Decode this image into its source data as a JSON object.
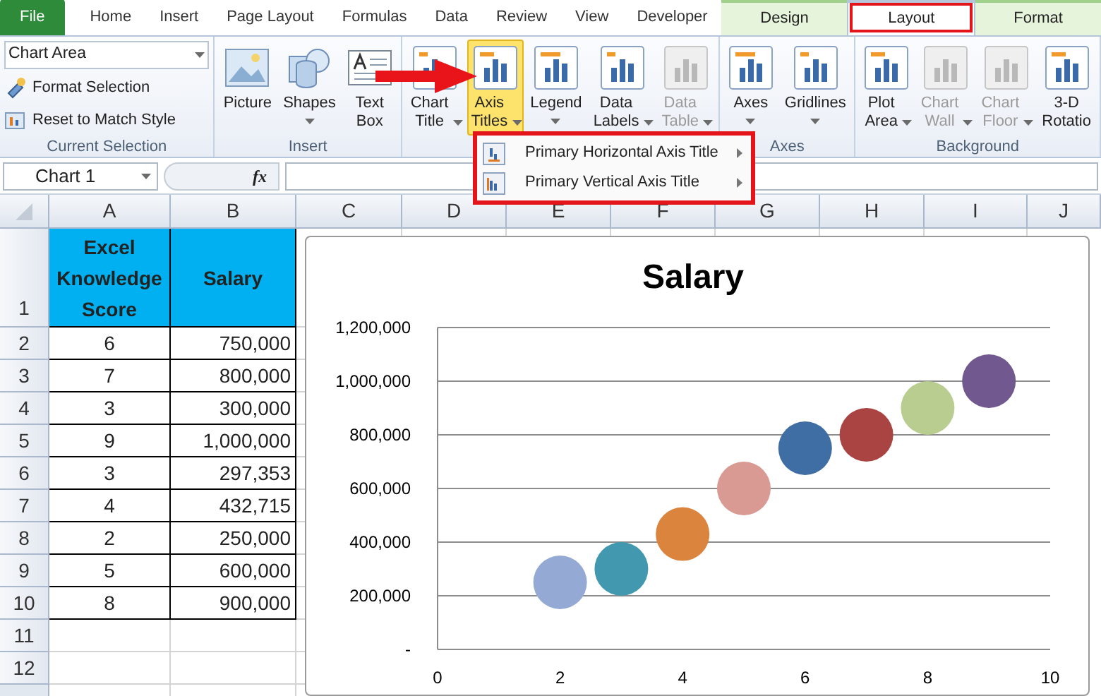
{
  "tabs": [
    {
      "label": "File",
      "kind": "file",
      "selected": false,
      "contextual": false,
      "highlighted": false
    },
    {
      "label": "Home",
      "kind": "tab",
      "selected": false,
      "contextual": false,
      "highlighted": false
    },
    {
      "label": "Insert",
      "kind": "tab",
      "selected": false,
      "contextual": false,
      "highlighted": false
    },
    {
      "label": "Page Layout",
      "kind": "tab",
      "selected": false,
      "contextual": false,
      "highlighted": false
    },
    {
      "label": "Formulas",
      "kind": "tab",
      "selected": false,
      "contextual": false,
      "highlighted": false
    },
    {
      "label": "Data",
      "kind": "tab",
      "selected": false,
      "contextual": false,
      "highlighted": false
    },
    {
      "label": "Review",
      "kind": "tab",
      "selected": false,
      "contextual": false,
      "highlighted": false
    },
    {
      "label": "View",
      "kind": "tab",
      "selected": false,
      "contextual": false,
      "highlighted": false
    },
    {
      "label": "Developer",
      "kind": "tab",
      "selected": false,
      "contextual": false,
      "highlighted": false
    },
    {
      "label": "Design",
      "kind": "tab",
      "selected": false,
      "contextual": true,
      "highlighted": false
    },
    {
      "label": "Layout",
      "kind": "tab",
      "selected": true,
      "contextual": true,
      "highlighted": true
    },
    {
      "label": "Format",
      "kind": "tab",
      "selected": false,
      "contextual": true,
      "highlighted": false
    }
  ],
  "ribbon": {
    "groups": [
      {
        "kind": "selection",
        "label": "Current Selection",
        "dropdown": "Chart Area",
        "items": [
          "Format Selection",
          "Reset to Match Style"
        ]
      },
      {
        "kind": "buttons",
        "label": "Insert",
        "buttons": [
          {
            "label": "Picture",
            "dropdown": false,
            "disabled": false,
            "selected": false
          },
          {
            "label": "Shapes",
            "dropdown": true,
            "disabled": false,
            "selected": false
          },
          {
            "label": "Text Box",
            "dropdown": false,
            "disabled": false,
            "selected": false
          }
        ]
      },
      {
        "kind": "buttons",
        "buttons": [
          {
            "label": "Chart Title",
            "dropdown": true,
            "disabled": false,
            "selected": false
          },
          {
            "label": "Axis Titles",
            "dropdown": true,
            "disabled": false,
            "selected": true
          },
          {
            "label": "Legend",
            "dropdown": true,
            "disabled": false,
            "selected": false
          },
          {
            "label": "Data Labels",
            "dropdown": true,
            "disabled": false,
            "selected": false
          },
          {
            "label": "Data Table",
            "dropdown": true,
            "disabled": true,
            "selected": false
          }
        ]
      },
      {
        "kind": "buttons",
        "label": "Axes",
        "buttons": [
          {
            "label": "Axes",
            "dropdown": true,
            "disabled": false,
            "selected": false
          },
          {
            "label": "Gridlines",
            "dropdown": true,
            "disabled": false,
            "selected": false
          }
        ]
      },
      {
        "kind": "buttons",
        "label": "Background",
        "buttons": [
          {
            "label": "Plot Area",
            "dropdown": true,
            "disabled": false,
            "selected": false
          },
          {
            "label": "Chart Wall",
            "dropdown": true,
            "disabled": true,
            "selected": false
          },
          {
            "label": "Chart Floor",
            "dropdown": true,
            "disabled": true,
            "selected": false
          },
          {
            "label": "3-D Rotatio",
            "dropdown": false,
            "disabled": false,
            "selected": false
          }
        ]
      }
    ]
  },
  "menu": {
    "highlighted": true,
    "items": [
      {
        "label": "Primary Horizontal Axis Title"
      },
      {
        "label": "Primary Vertical Axis Title"
      }
    ]
  },
  "formula_bar": {
    "name_box": "Chart 1",
    "fx": "fx"
  },
  "sheet": {
    "columns": [
      "A",
      "B",
      "C",
      "D",
      "E",
      "F",
      "G",
      "H",
      "I",
      "J"
    ],
    "rows": [
      {
        "number": "1",
        "cells": [
          "Excel Knowledge Score",
          "Salary"
        ],
        "header": true
      },
      {
        "number": "2",
        "cells": [
          "6",
          "750,000"
        ],
        "header": false
      },
      {
        "number": "3",
        "cells": [
          "7",
          "800,000"
        ],
        "header": false
      },
      {
        "number": "4",
        "cells": [
          "3",
          "300,000"
        ],
        "header": false
      },
      {
        "number": "5",
        "cells": [
          "9",
          "1,000,000"
        ],
        "header": false
      },
      {
        "number": "6",
        "cells": [
          "3",
          "297,353"
        ],
        "header": false
      },
      {
        "number": "7",
        "cells": [
          "4",
          "432,715"
        ],
        "header": false
      },
      {
        "number": "8",
        "cells": [
          "2",
          "250,000"
        ],
        "header": false
      },
      {
        "number": "9",
        "cells": [
          "5",
          "600,000"
        ],
        "header": false
      },
      {
        "number": "10",
        "cells": [
          "8",
          "900,000"
        ],
        "header": false
      },
      {
        "number": "11",
        "cells": [],
        "header": false
      },
      {
        "number": "12",
        "cells": [],
        "header": false
      }
    ]
  },
  "chart": {
    "chart_data": {
      "type": "scatter",
      "title": "Salary",
      "x": [
        2,
        3,
        4,
        5,
        6,
        7,
        8,
        9
      ],
      "grid": true,
      "series": [
        {
          "colors": [
            "#95a9d5",
            "#4198af",
            "#db843d",
            "#d99a94",
            "#3f6ea5",
            "#a94442",
            "#b8cd8f",
            "#71588f"
          ],
          "values": [
            250000,
            300000,
            430000,
            600000,
            750000,
            800000,
            900000,
            1000000
          ]
        }
      ],
      "xlim": [
        0,
        10
      ],
      "ylim": [
        0,
        1200000
      ],
      "xticks": [
        0,
        2,
        4,
        6,
        8,
        10
      ],
      "yticks": [
        {
          "value": 0,
          "label": "-"
        },
        {
          "value": 200000,
          "label": "200,000"
        },
        {
          "value": 400000,
          "label": "400,000"
        },
        {
          "value": 600000,
          "label": "600,000"
        },
        {
          "value": 800000,
          "label": "800,000"
        },
        {
          "value": 1000000,
          "label": "1,000,000"
        },
        {
          "value": 1200000,
          "label": "1,200,000"
        }
      ]
    }
  }
}
